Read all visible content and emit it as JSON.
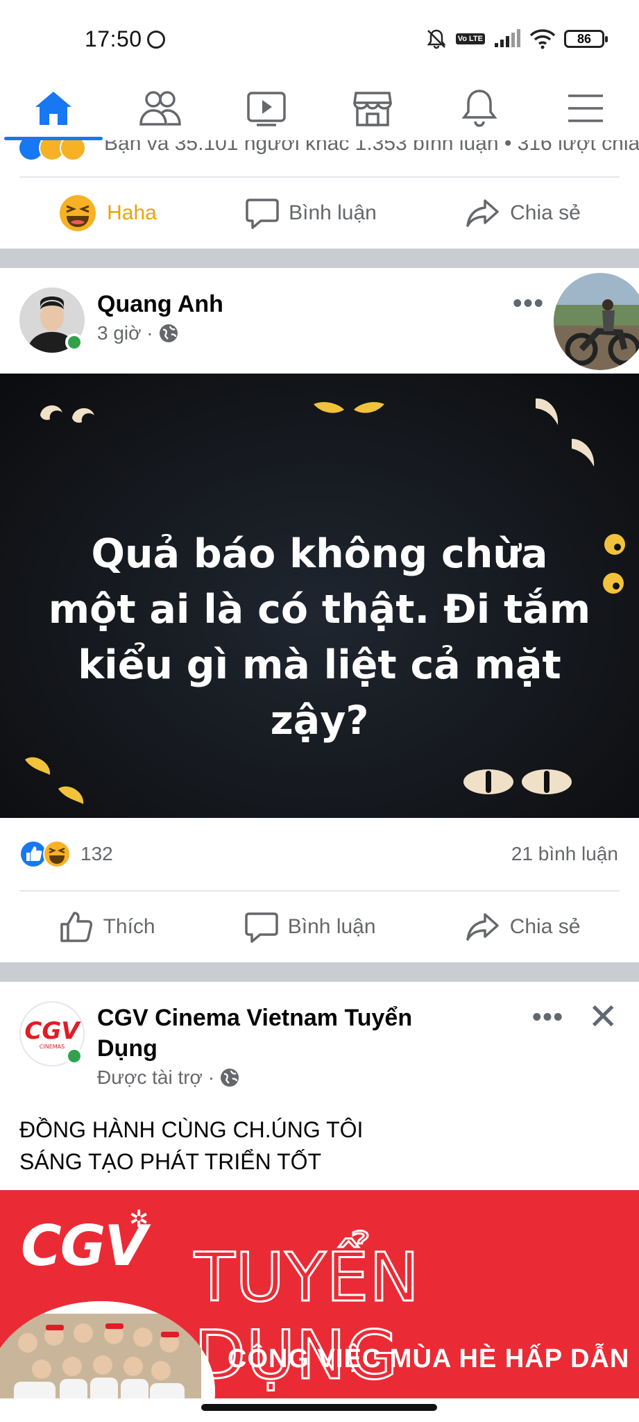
{
  "status_bar": {
    "time": "17:50",
    "volte": "Vo LTE",
    "battery": "86"
  },
  "nav": {
    "tabs": [
      {
        "icon": "home-icon",
        "active": true
      },
      {
        "icon": "friends-icon",
        "active": false
      },
      {
        "icon": "watch-icon",
        "active": false
      },
      {
        "icon": "marketplace-icon",
        "active": false
      },
      {
        "icon": "notifications-icon",
        "active": false
      },
      {
        "icon": "menu-icon",
        "active": false
      }
    ],
    "accent": "#1877f2"
  },
  "prev_post": {
    "stats_text": "Bạn và 35.101 người khác  1.353 bình luận • 316 lượt chia",
    "actions": {
      "react": "Haha",
      "comment": "Bình luận",
      "share": "Chia sẻ"
    }
  },
  "post": {
    "author": "Quang Anh",
    "time": "3 giờ ·",
    "quote": "Quả báo không chừa một ai là có thật. Đi tắm kiểu gì mà liệt cả mặt zậy?",
    "reaction_count": "132",
    "comment_count": "21 bình luận",
    "actions": {
      "like": "Thích",
      "comment": "Bình luận",
      "share": "Chia sẻ"
    }
  },
  "ad": {
    "page_name": "CGV Cinema Vietnam Tuyển Dụng",
    "sponsored": "Được tài trợ ·",
    "avatar_text": "CGV",
    "avatar_subtext": "CINEMAS",
    "body_line1": "ĐỒNG HÀNH CÙNG CH.ÚNG TÔI",
    "body_line2": "SÁNG TẠO PHÁT TRIỂN TỐT",
    "banner_logo": "CGV",
    "banner_title": "TUYỂN DỤNG",
    "banner_subtitle": "CÔNG VIỆC MÙA HÈ HẤP DẪN",
    "brand_color": "#ea2b35"
  }
}
